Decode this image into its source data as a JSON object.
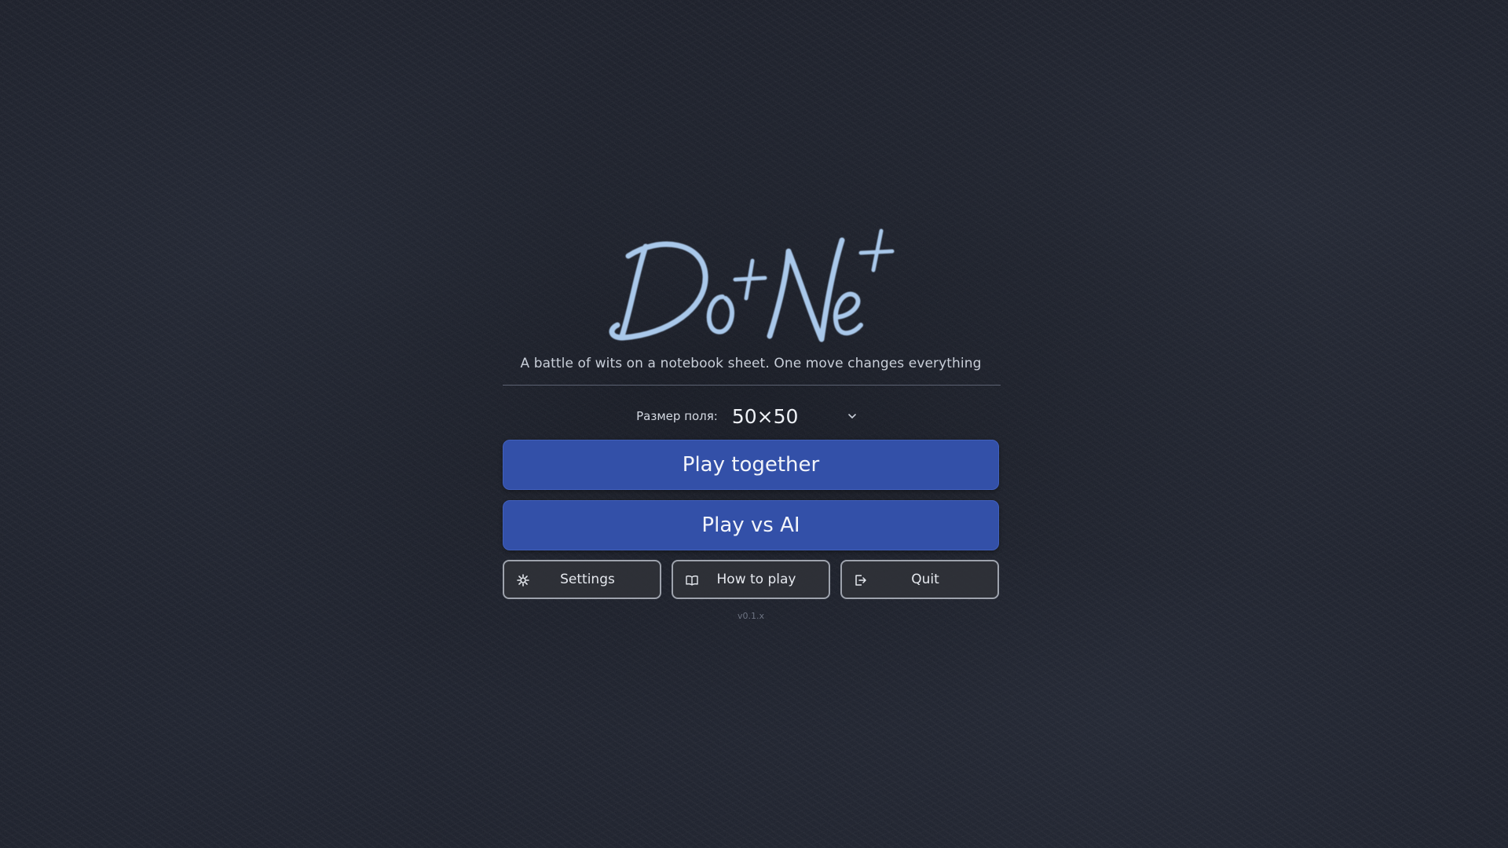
{
  "app": {
    "logo_text": "Do+Ne+",
    "tagline": "A battle of wits on a notebook sheet. One move changes everything"
  },
  "board_size": {
    "label": "Размер поля:",
    "selected": "50×50"
  },
  "buttons": {
    "play_together": "Play together",
    "play_vs_ai": "Play vs AI",
    "settings": "Settings",
    "how_to_play": "How to play",
    "quit": "Quit"
  },
  "icons": {
    "settings": "gear-icon",
    "how_to_play": "book-icon",
    "quit": "exit-icon",
    "size_select": "chevron-down-icon"
  },
  "colors": {
    "background": "#171a24",
    "primary_button": "#3350a8",
    "logo": "#a9c8ea",
    "secondary_border": "#9ea3ad"
  },
  "version": "v0.1.x"
}
